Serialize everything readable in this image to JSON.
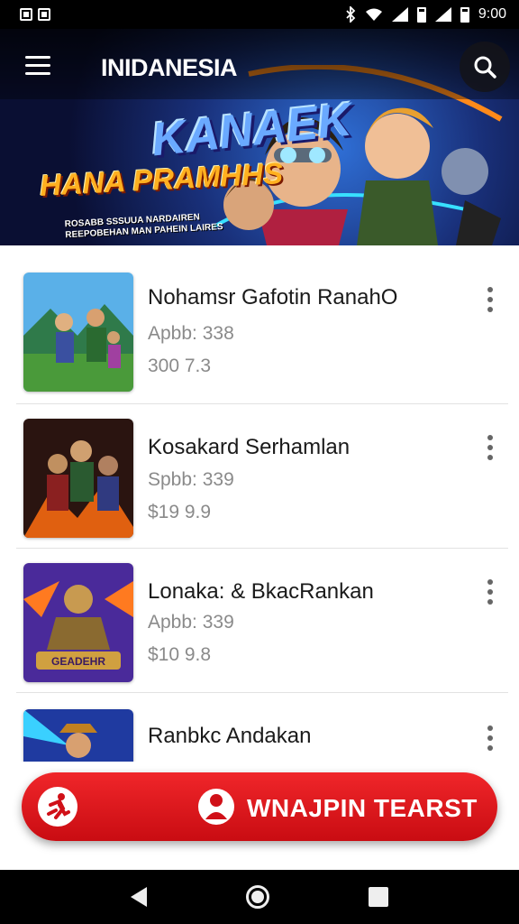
{
  "status_bar": {
    "time": "9:00"
  },
  "header": {
    "title": "INIDANESIA"
  },
  "hero": {
    "logo_text": "KANAEK",
    "headline": "HANA PRAMHHS",
    "subtext": "ROSABB SSSUUA NARDAIREN REEPOBEHAN MAN PAHEIN LAIRES"
  },
  "list": {
    "items": [
      {
        "title": "Nohamsr Gafotin RanahO",
        "meta1": "Apbb: 338",
        "meta2": "300 7.3"
      },
      {
        "title": "Kosakard Serhamlan",
        "meta1": "Spbb: 339",
        "meta2": "$19 9.9"
      },
      {
        "title": "Lonaka: & BkacRankan",
        "meta1": "Apbb: 339",
        "meta2": "$10 9.8",
        "thumb_text": "GEADEHR"
      },
      {
        "title": "Ranbkc Andakan",
        "meta1": "",
        "meta2": ""
      }
    ]
  },
  "action_button": {
    "label": "WNAJPIN TEARST"
  },
  "icons": {
    "menu": "menu-icon",
    "search": "search-icon",
    "more": "more-vert-icon",
    "back": "back-icon",
    "home": "home-icon",
    "recent": "recent-apps-icon"
  },
  "colors": {
    "accent": "#e0141a",
    "hero_bg": "#19307a"
  }
}
